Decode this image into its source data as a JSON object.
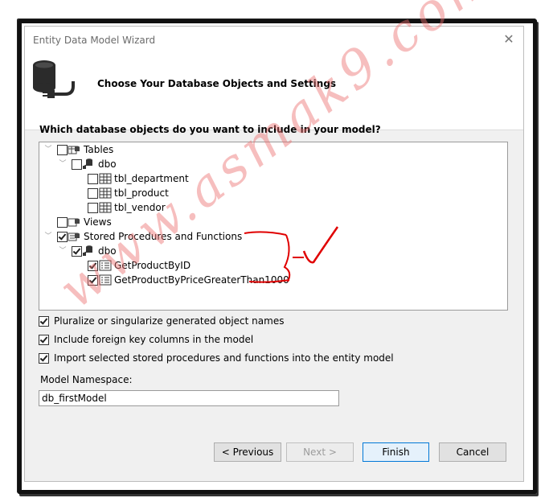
{
  "window": {
    "title": "Entity Data Model Wizard",
    "close_glyph": "✕"
  },
  "header": {
    "icon": "database-plug-icon",
    "title": "Choose Your Database Objects and Settings"
  },
  "question": "Which database objects do you want to include in your model?",
  "tree": {
    "tables": {
      "label": "Tables",
      "checked": false,
      "schema": {
        "label": "dbo",
        "checked": false,
        "items": [
          {
            "label": "tbl_department",
            "checked": false
          },
          {
            "label": "tbl_product",
            "checked": false
          },
          {
            "label": "tbl_vendor",
            "checked": false
          }
        ]
      }
    },
    "views": {
      "label": "Views",
      "checked": false
    },
    "procs": {
      "label": "Stored Procedures and Functions",
      "checked": true,
      "schema": {
        "label": "dbo",
        "checked": true,
        "items": [
          {
            "label": "GetProductByID",
            "checked": true
          },
          {
            "label": "GetProductByPriceGreaterThan1000",
            "checked": true
          }
        ]
      }
    }
  },
  "options": [
    {
      "label": "Pluralize or singularize generated object names",
      "checked": true
    },
    {
      "label": "Include foreign key columns in the model",
      "checked": true
    },
    {
      "label": "Import selected stored procedures and functions into the entity model",
      "checked": true
    }
  ],
  "namespace": {
    "label": "Model Namespace:",
    "value": "db_firstModel"
  },
  "buttons": {
    "previous": "< Previous",
    "next": "Next >",
    "finish": "Finish",
    "cancel": "Cancel"
  },
  "watermark": "www.asmak9.com",
  "colors": {
    "accent": "#0078d7",
    "annotation_red": "#e00000",
    "watermark": "#ec6e6e"
  }
}
